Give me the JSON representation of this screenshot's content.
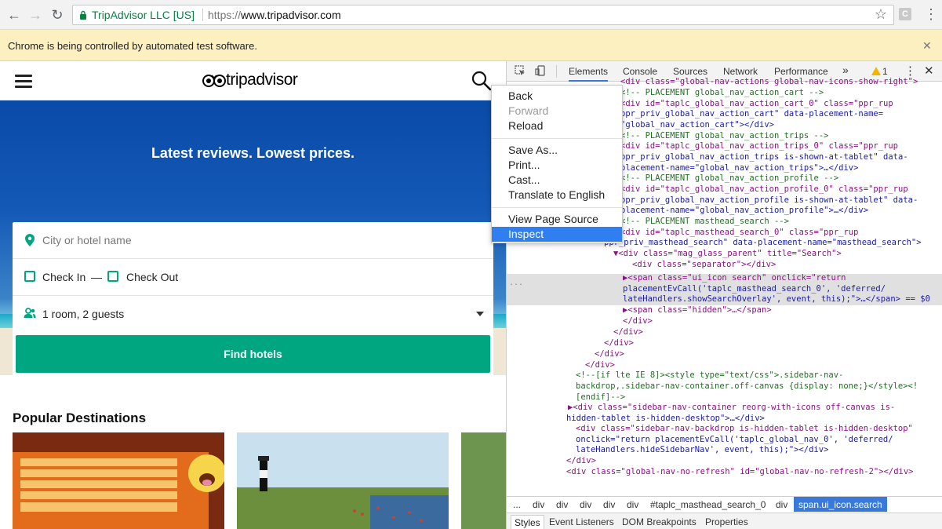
{
  "browser": {
    "site_identity": "TripAdvisor LLC [US]",
    "url_scheme": "https://",
    "url_host": "www.tripadvisor.com",
    "extension_label": "C",
    "infobar_text": "Chrome is being controlled by automated test software."
  },
  "page": {
    "logo_text": "tripadvisor",
    "tagline": "Latest reviews. Lowest prices.",
    "search": {
      "city_placeholder": "City or hotel name",
      "check_in": "Check In",
      "dash": "—",
      "check_out": "Check Out",
      "guests": "1 room, 2 guests",
      "find_button": "Find hotels"
    },
    "popular_title": "Popular Destinations"
  },
  "context_menu": {
    "items": [
      "Back",
      "Forward",
      "Reload",
      "Save As...",
      "Print...",
      "Cast...",
      "Translate to English",
      "View Page Source",
      "Inspect"
    ]
  },
  "devtools": {
    "tabs": [
      "Elements",
      "Console",
      "Sources",
      "Network",
      "Performance",
      "»"
    ],
    "warning_count": "1",
    "code_lines": [
      "<div class=\"global-nav-actions global-nav-icons-show-right\">",
      "<!-- PLACEMENT global_nav_action_cart -->",
      "<div id=\"taplc_global_nav_action_cart_0\" class=\"ppr_rup",
      "ppr_priv_global_nav_action_cart\" data-placement-name=",
      "\"global_nav_action_cart\"></div>",
      "<!-- PLACEMENT global_nav_action_trips -->",
      "<div id=\"taplc_global_nav_action_trips_0\" class=\"ppr_rup",
      "ppr_priv_global_nav_action_trips is-shown-at-tablet\" data-",
      "placement-name=\"global_nav_action_trips\">…</div>",
      "<!-- PLACEMENT global_nav_action_profile -->",
      "<div id=\"taplc_global_nav_action_profile_0\" class=\"ppr_rup",
      "ppr_priv_global_nav_action_profile is-shown-at-tablet\" data-",
      "placement-name=\"global_nav_action_profile\">…</div>",
      "<!-- PLACEMENT masthead_search -->",
      "<div id=\"taplc_masthead_search_0\" class=\"ppr_rup",
      "ppr_priv_masthead_search\" data-placement-name=\"masthead_search\">",
      "▼<div class=\"mag_glass_parent\" title=\"Search\">",
      "<div class=\"separator\"></div>",
      "▶<span class=\"ui_icon search\" onclick=\"return",
      "placementEvCall('taplc_masthead_search_0', 'deferred/",
      "lateHandlers.showSearchOverlay', event, this);\">…</span> == $0",
      "▶<span class=\"hidden\">…</span>",
      "</div>",
      "</div>",
      "</div>",
      "</div>",
      "</div>",
      "<!--[if lte IE 8]><style type=\"text/css\">.sidebar-nav-",
      "backdrop,.sidebar-nav-container.off-canvas {display: none;}</style><!",
      "[endif]-->",
      "▶<div class=\"sidebar-nav-container reorg-with-icons off-canvas is-",
      "hidden-tablet is-hidden-desktop\">…</div>",
      "<div class=\"sidebar-nav-backdrop is-hidden-tablet is-hidden-desktop\"",
      "onclick=\"return placementEvCall('taplc_global_nav_0', 'deferred/",
      "lateHandlers.hideSidebarNav', event, this);\"></div>",
      "</div>",
      "<div class=\"global-nav-no-refresh\" id=\"global-nav-no-refresh-2\"></div>"
    ],
    "breadcrumbs": [
      "...",
      "div",
      "div",
      "div",
      "div",
      "div",
      "#taplc_masthead_search_0",
      "div"
    ],
    "breadcrumb_active": "span.ui_icon.search",
    "subtabs": [
      "Styles",
      "Event Listeners",
      "DOM Breakpoints",
      "Properties"
    ],
    "gutter_ellipsis": "..."
  },
  "colors": {
    "accent_green": "#00a680",
    "hero_blue": "#0a4aa8",
    "selection_blue": "#2f7ff0",
    "devtools_blue": "#3879d9",
    "infobar_yellow": "#fcefc0"
  }
}
